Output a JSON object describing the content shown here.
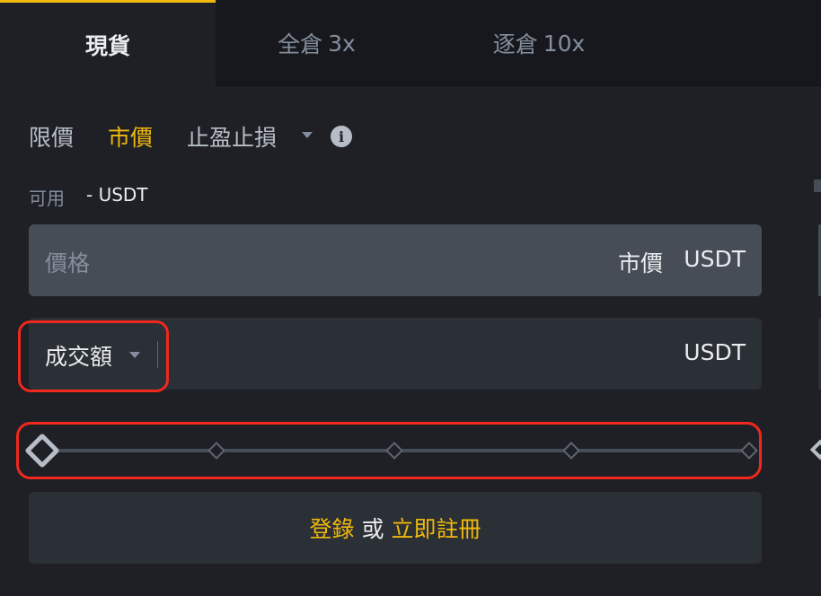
{
  "tabs": {
    "spot": {
      "label": "現貨"
    },
    "cross": {
      "label": "全倉",
      "leverage": "3x"
    },
    "isolated": {
      "label": "逐倉",
      "leverage": "10x"
    }
  },
  "order_types": {
    "limit": "限價",
    "market": "市價",
    "tpsl": "止盈止損",
    "active": "market"
  },
  "available": {
    "label": "可用",
    "value": "- USDT"
  },
  "price_field": {
    "placeholder": "價格",
    "value": "市價",
    "unit": "USDT"
  },
  "amount_field": {
    "mode": "成交額",
    "unit": "USDT"
  },
  "slider": {
    "value_percent": 0,
    "ticks_percent": [
      0,
      25,
      50,
      75,
      100
    ]
  },
  "login": {
    "login_label": "登錄",
    "or_label": "或",
    "register_label": "立即註冊"
  },
  "colors": {
    "accent": "#f0b90b",
    "background": "#1e2026",
    "tabbar": "#16181d",
    "annotation": "#f0281e"
  },
  "icons": {
    "info": "info-icon",
    "dropdown": "caret-down-icon"
  }
}
